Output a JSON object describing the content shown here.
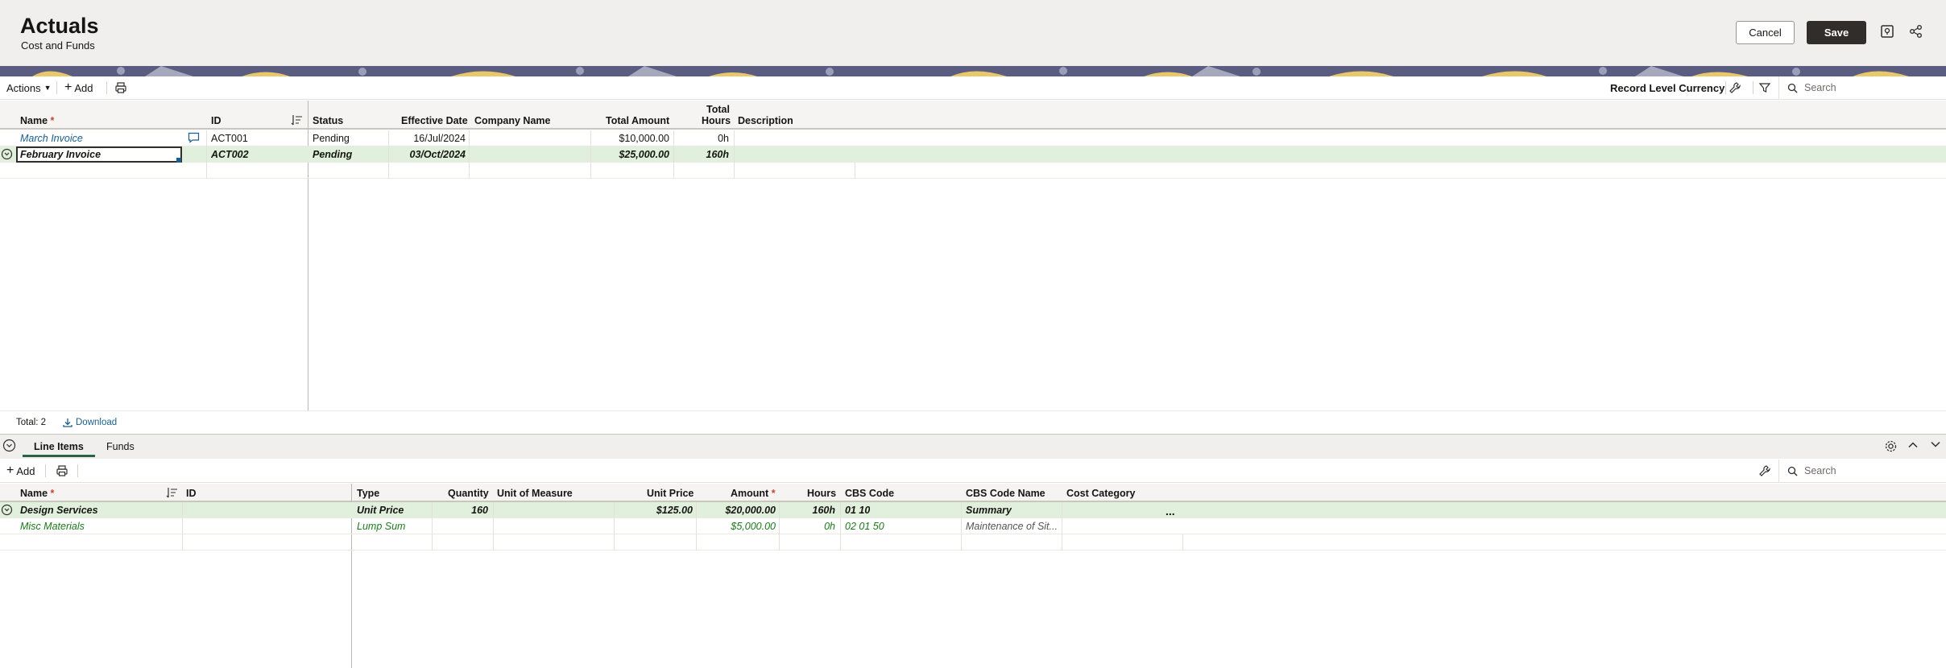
{
  "header": {
    "title": "Actuals",
    "subtitle": "Cost and Funds",
    "cancel_label": "Cancel",
    "save_label": "Save"
  },
  "toolbar": {
    "actions_label": "Actions",
    "add_label": "Add",
    "currency_label": "Record Level Currency",
    "search_placeholder": "Search"
  },
  "actuals_table": {
    "columns": {
      "name": "Name",
      "id": "ID",
      "status": "Status",
      "effective_date": "Effective Date",
      "company_name": "Company Name",
      "total_amount": "Total Amount",
      "total_hours_1": "Total",
      "total_hours_2": "Hours",
      "description": "Description"
    },
    "rows": [
      {
        "name": "March Invoice",
        "id": "ACT001",
        "status": "Pending",
        "effective_date": "16/Jul/2024",
        "company_name": "",
        "total_amount": "$10,000.00",
        "total_hours": "0h",
        "description": ""
      },
      {
        "name": "February Invoice",
        "id": "ACT002",
        "status": "Pending",
        "effective_date": "03/Oct/2024",
        "company_name": "",
        "total_amount": "$25,000.00",
        "total_hours": "160h",
        "description": ""
      }
    ]
  },
  "footer": {
    "total_label": "Total: 2",
    "download_label": "Download"
  },
  "tabs": {
    "line_items": "Line Items",
    "funds": "Funds"
  },
  "line_toolbar": {
    "add_label": "Add",
    "search_placeholder": "Search"
  },
  "line_table": {
    "columns": {
      "name": "Name",
      "id": "ID",
      "type": "Type",
      "quantity": "Quantity",
      "unit_of_measure": "Unit of Measure",
      "unit_price": "Unit Price",
      "amount": "Amount",
      "hours": "Hours",
      "cbs_code": "CBS Code",
      "cbs_code_name": "CBS Code Name",
      "cost_category": "Cost Category"
    },
    "rows": [
      {
        "name": "Design Services",
        "id": "",
        "type": "Unit Price",
        "quantity": "160",
        "unit_of_measure": "",
        "unit_price": "$125.00",
        "amount": "$20,000.00",
        "hours": "160h",
        "cbs_code": "01 10",
        "cbs_code_name": "Summary",
        "cost_category": "",
        "more": "..."
      },
      {
        "name": "Misc Materials",
        "id": "",
        "type": "Lump Sum",
        "quantity": "",
        "unit_of_measure": "",
        "unit_price": "",
        "amount": "$5,000.00",
        "hours": "0h",
        "cbs_code": "02 01 50",
        "cbs_code_name": "Maintenance of Sit...",
        "cost_category": ""
      }
    ]
  }
}
